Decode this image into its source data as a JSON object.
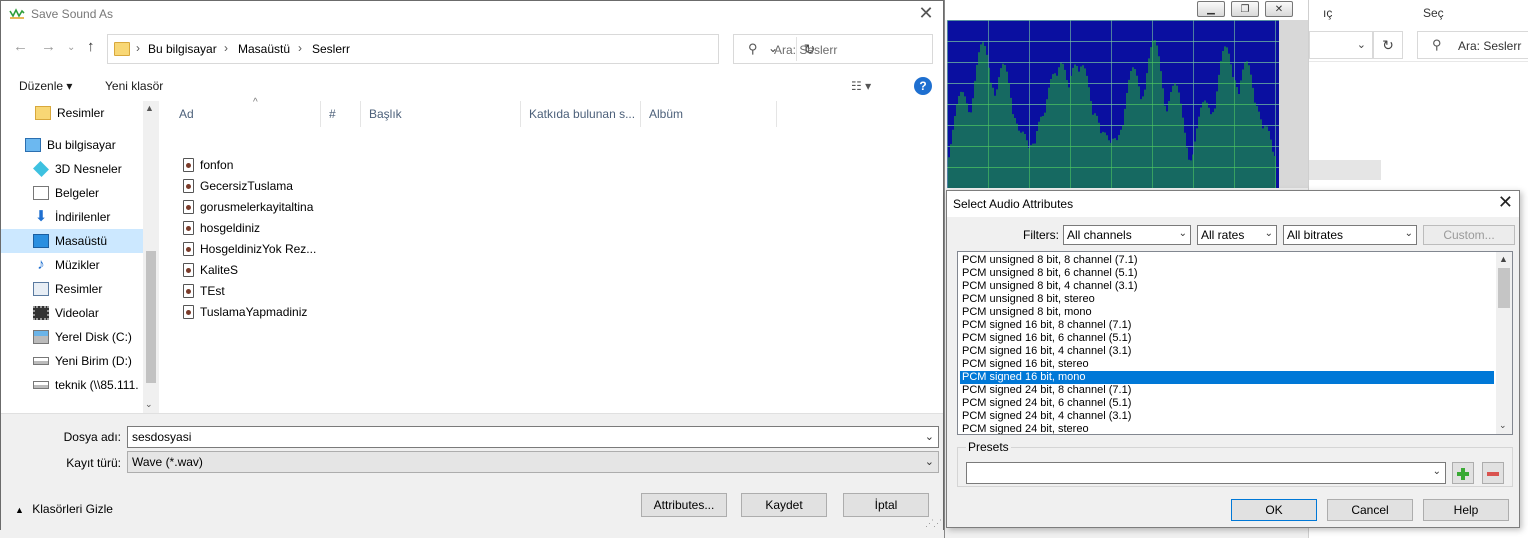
{
  "background": {
    "right_header": "Seç",
    "right_header_left": "ıç",
    "search_placeholder": "Ara: Seslerr"
  },
  "save_dialog": {
    "title": "Save Sound As",
    "breadcrumb": [
      "Bu bilgisayar",
      "Masaüstü",
      "Seslerr"
    ],
    "search_placeholder": "Ara: Seslerr",
    "toolbar": {
      "organize": "Düzenle ▾",
      "new_folder": "Yeni klasör"
    },
    "nav_items": [
      {
        "label": "Resimler",
        "icon": "folder-icon"
      },
      {
        "label": "Bu bilgisayar",
        "icon": "computer-icon"
      },
      {
        "label": "3D Nesneler",
        "icon": "cube-icon"
      },
      {
        "label": "Belgeler",
        "icon": "document-icon"
      },
      {
        "label": "İndirilenler",
        "icon": "download-icon"
      },
      {
        "label": "Masaüstü",
        "icon": "desktop-icon",
        "selected": true
      },
      {
        "label": "Müzikler",
        "icon": "music-icon"
      },
      {
        "label": "Resimler",
        "icon": "pictures-icon"
      },
      {
        "label": "Videolar",
        "icon": "video-icon"
      },
      {
        "label": "Yerel Disk (C:)",
        "icon": "disk-icon"
      },
      {
        "label": "Yeni Birim (D:)",
        "icon": "disk-icon"
      },
      {
        "label": "teknik (\\\\85.111.",
        "icon": "network-drive-icon"
      }
    ],
    "columns": [
      "Ad",
      "#",
      "Başlık",
      "Katkıda bulunan s...",
      "Albüm"
    ],
    "files": [
      "fonfon",
      "GecersizTuslama",
      "gorusmelerkayitaltina",
      "hosgeldiniz",
      "HosgeldinizYok Rez...",
      "KaliteS",
      "TEst",
      "TuslamaYapmadiniz"
    ],
    "filename_label": "Dosya adı:",
    "filename_value": "sesdosyasi",
    "filetype_label": "Kayıt türü:",
    "filetype_value": "Wave (*.wav)",
    "hide_folders": "Klasörleri Gizle",
    "buttons": {
      "attributes": "Attributes...",
      "save": "Kaydet",
      "cancel": "İptal"
    }
  },
  "attr_dialog": {
    "title": "Select Audio Attributes",
    "filters_label": "Filters:",
    "channels": "All channels",
    "rates": "All rates",
    "bitrates": "All bitrates",
    "custom": "Custom...",
    "formats": [
      "PCM unsigned 8 bit, 8 channel (7.1)",
      "PCM unsigned 8 bit, 6 channel (5.1)",
      "PCM unsigned 8 bit, 4 channel (3.1)",
      "PCM unsigned 8 bit, stereo",
      "PCM unsigned 8 bit, mono",
      "PCM signed 16 bit, 8 channel (7.1)",
      "PCM signed 16 bit, 6 channel (5.1)",
      "PCM signed 16 bit, 4 channel (3.1)",
      "PCM signed 16 bit, stereo",
      "PCM signed 16 bit, mono",
      "PCM signed 24 bit, 8 channel (7.1)",
      "PCM signed 24 bit, 6 channel (5.1)",
      "PCM signed 24 bit, 4 channel (3.1)",
      "PCM signed 24 bit, stereo"
    ],
    "selected_format": "PCM signed 16 bit, mono",
    "presets_label": "Presets",
    "buttons": {
      "ok": "OK",
      "cancel": "Cancel",
      "help": "Help"
    }
  },
  "colors": {
    "selection": "#0078d7",
    "nav_selection": "#cce8ff",
    "plot_bg": "#0a0fa0",
    "waveform": "#22c322"
  }
}
